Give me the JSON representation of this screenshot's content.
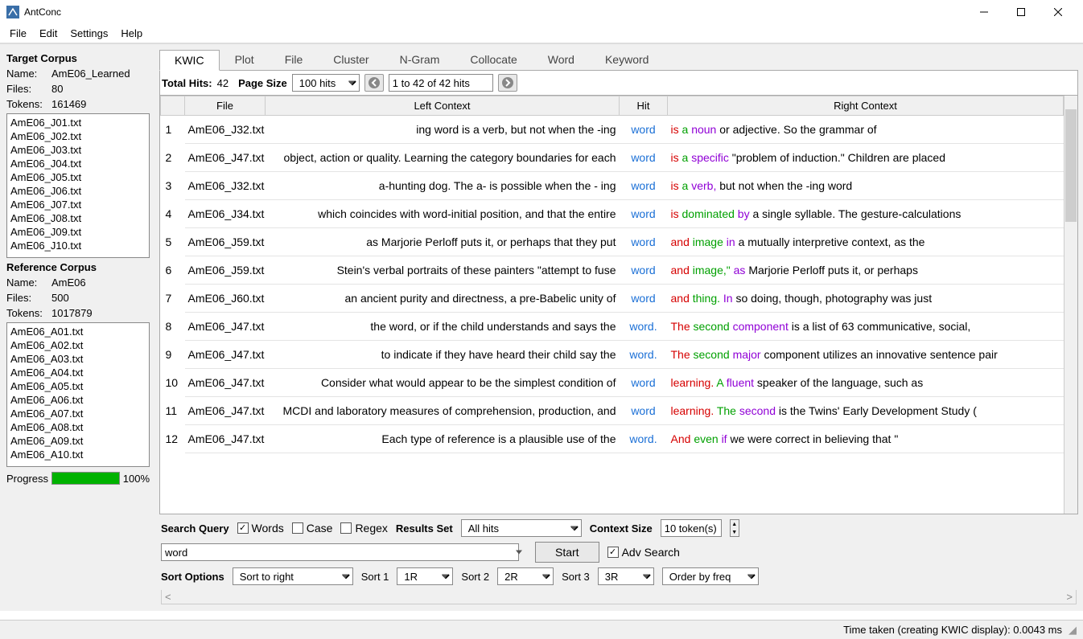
{
  "app": {
    "title": "AntConc"
  },
  "menu": [
    "File",
    "Edit",
    "Settings",
    "Help"
  ],
  "target_corpus": {
    "header": "Target Corpus",
    "name_label": "Name:",
    "name": "AmE06_Learned",
    "files_label": "Files:",
    "files": "80",
    "tokens_label": "Tokens:",
    "tokens": "161469",
    "files_list": [
      "AmE06_J01.txt",
      "AmE06_J02.txt",
      "AmE06_J03.txt",
      "AmE06_J04.txt",
      "AmE06_J05.txt",
      "AmE06_J06.txt",
      "AmE06_J07.txt",
      "AmE06_J08.txt",
      "AmE06_J09.txt",
      "AmE06_J10.txt"
    ]
  },
  "reference_corpus": {
    "header": "Reference Corpus",
    "name_label": "Name:",
    "name": "AmE06",
    "files_label": "Files:",
    "files": "500",
    "tokens_label": "Tokens:",
    "tokens": "1017879",
    "files_list": [
      "AmE06_A01.txt",
      "AmE06_A02.txt",
      "AmE06_A03.txt",
      "AmE06_A04.txt",
      "AmE06_A05.txt",
      "AmE06_A06.txt",
      "AmE06_A07.txt",
      "AmE06_A08.txt",
      "AmE06_A09.txt",
      "AmE06_A10.txt"
    ]
  },
  "progress": {
    "label": "Progress",
    "percent": "100%"
  },
  "tabs": [
    "KWIC",
    "Plot",
    "File",
    "Cluster",
    "N-Gram",
    "Collocate",
    "Word",
    "Keyword"
  ],
  "hits": {
    "total_label": "Total Hits:",
    "total": "42",
    "page_size_label": "Page Size",
    "page_size": "100 hits",
    "range_text": "1 to 42 of 42 hits"
  },
  "columns": [
    "",
    "File",
    "Left Context",
    "Hit",
    "Right Context"
  ],
  "rows": [
    {
      "n": "1",
      "file": "AmE06_J32.txt",
      "left": "ing word is a verb, but not when the -ing",
      "hit": "word",
      "r1": "is",
      "r2": "a",
      "r3": "noun",
      "rest": " or adjective. So the grammar of"
    },
    {
      "n": "2",
      "file": "AmE06_J47.txt",
      "left": "object, action or quality. Learning the category boundaries for each",
      "hit": "word",
      "r1": "is",
      "r2": "a",
      "r3": "specific",
      "rest": " \"problem of induction.\" Children are placed"
    },
    {
      "n": "3",
      "file": "AmE06_J32.txt",
      "left": "a-hunting dog. The a- is possible when the - ing",
      "hit": "word",
      "r1": "is",
      "r2": "a",
      "r3": "verb,",
      "rest": " but not when the -ing word"
    },
    {
      "n": "4",
      "file": "AmE06_J34.txt",
      "left": "which coincides with word-initial position, and that the entire",
      "hit": "word",
      "r1": "is",
      "r2": "dominated",
      "r3": "by",
      "rest": " a single syllable. The gesture-calculations"
    },
    {
      "n": "5",
      "file": "AmE06_J59.txt",
      "left": "as Marjorie Perloff puts it, or perhaps that they put",
      "hit": "word",
      "r1": "and",
      "r2": "image",
      "r3": "in",
      "rest": " a mutually interpretive context, as the"
    },
    {
      "n": "6",
      "file": "AmE06_J59.txt",
      "left": "Stein's verbal portraits of these painters \"attempt to fuse",
      "hit": "word",
      "r1": "and",
      "r2": "image,\"",
      "r3": "as",
      "rest": " Marjorie Perloff puts it, or perhaps"
    },
    {
      "n": "7",
      "file": "AmE06_J60.txt",
      "left": "an ancient purity and directness, a pre-Babelic unity of",
      "hit": "word",
      "r1": "and",
      "r2": "thing.",
      "r3": "In",
      "rest": " so doing, though, photography was just"
    },
    {
      "n": "8",
      "file": "AmE06_J47.txt",
      "left": "the word, or if the child understands and says the",
      "hit": "word.",
      "r1": "The",
      "r2": "second",
      "r3": "component",
      "rest": " is a list of 63 communicative, social,"
    },
    {
      "n": "9",
      "file": "AmE06_J47.txt",
      "left": "to indicate if they have heard their child say the",
      "hit": "word.",
      "r1": "The",
      "r2": "second",
      "r3": "major",
      "rest": " component utilizes an innovative sentence pair"
    },
    {
      "n": "10",
      "file": "AmE06_J47.txt",
      "left": "Consider what would appear to be the simplest condition of",
      "hit": "word",
      "r1": "learning.",
      "r2": "A",
      "r3": "fluent",
      "rest": " speaker of the language, such as"
    },
    {
      "n": "11",
      "file": "AmE06_J47.txt",
      "left": "MCDI and laboratory measures of comprehension, production, and",
      "hit": "word",
      "r1": "learning.",
      "r2": "The",
      "r3": "second",
      "rest": " is the Twins' Early Development Study ("
    },
    {
      "n": "12",
      "file": "AmE06_J47.txt",
      "left": "Each type of reference is a plausible use of the",
      "hit": "word.",
      "r1": "And",
      "r2": "even",
      "r3": "if",
      "rest": " we were correct in believing that \""
    }
  ],
  "search": {
    "query_label": "Search Query",
    "words_label": "Words",
    "case_label": "Case",
    "regex_label": "Regex",
    "results_set_label": "Results Set",
    "results_set_value": "All hits",
    "context_size_label": "Context Size",
    "context_size_value": "10 token(s)",
    "query_value": "word",
    "start_label": "Start",
    "adv_search_label": "Adv Search"
  },
  "sort": {
    "label": "Sort Options",
    "main": "Sort to right",
    "s1_label": "Sort 1",
    "s1": "1R",
    "s2_label": "Sort 2",
    "s2": "2R",
    "s3_label": "Sort 3",
    "s3": "3R",
    "order": "Order by freq"
  },
  "status": "Time taken (creating KWIC display): 0.0043 ms"
}
